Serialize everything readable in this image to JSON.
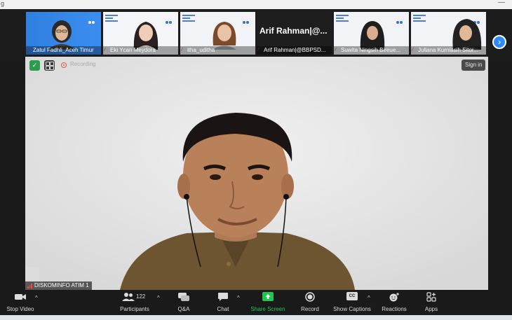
{
  "window": {
    "title": "g",
    "minimize_label": "—"
  },
  "participants_strip": {
    "tiles": [
      {
        "name": "Zatul Fadhli_Aceh Timur"
      },
      {
        "name": "Eki Ycan Meydora"
      },
      {
        "name": "itha_uditha"
      },
      {
        "name": "Arif Rahman|@BBPSD...",
        "display_text": "Arif  Rahman|@..."
      },
      {
        "name": "Suwita Ningsih Bireue..."
      },
      {
        "name": "Juliana Kurniasih Sitor..."
      }
    ],
    "next_page_label": "›"
  },
  "main_video": {
    "status": {
      "recording_label": "Recording"
    },
    "sign_in_label": "Sign in",
    "speaker_name": "DISKOMINFO ATIM 1"
  },
  "toolbar": {
    "stop_video": "Stop Video",
    "participants": "Participants",
    "participants_count": "122",
    "qa": "Q&A",
    "chat": "Chat",
    "share_screen": "Share Screen",
    "record": "Record",
    "show_captions": "Show Captions",
    "captions_badge": "CC",
    "reactions": "Reactions",
    "apps": "Apps"
  },
  "colors": {
    "accent": "#2d8cff",
    "share_green": "#23c552",
    "recording_red": "#e5533f",
    "secure_green": "#2e9b4f"
  }
}
